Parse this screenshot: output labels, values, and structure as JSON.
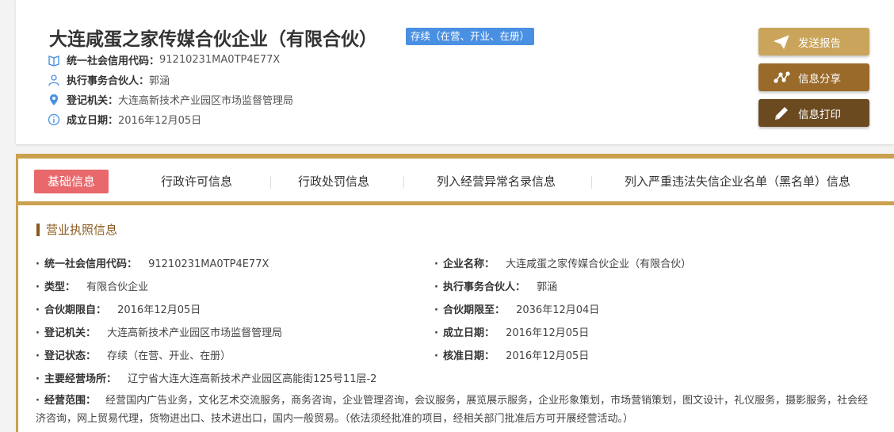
{
  "header": {
    "company_name": "大连咸蛋之家传媒合伙企业（有限合伙）",
    "status": "存续（在营、开业、在册）",
    "credit_code_label": "统一社会信用代码：",
    "credit_code": "91210231MA0TP4E77X",
    "partner_label": "执行事务合伙人：",
    "partner": "郭涵",
    "authority_label": "登记机关：",
    "authority": "大连高新技术产业园区市场监督管理局",
    "established_label": "成立日期：",
    "established": "2016年12月05日"
  },
  "actions": {
    "send": "发送报告",
    "share": "信息分享",
    "print": "信息打印"
  },
  "tabs": [
    {
      "label": "基础信息"
    },
    {
      "label": "行政许可信息"
    },
    {
      "label": "行政处罚信息"
    },
    {
      "label": "列入经营异常名录信息"
    },
    {
      "label": "列入严重违法失信企业名单（黑名单）信息"
    }
  ],
  "section": {
    "title": "营业执照信息"
  },
  "fields": {
    "credit_code": {
      "label": "统一社会信用代码：",
      "value": "91210231MA0TP4E77X"
    },
    "company_name": {
      "label": "企业名称：",
      "value": "大连咸蛋之家传媒合伙企业（有限合伙）"
    },
    "type": {
      "label": "类型：",
      "value": "有限合伙企业"
    },
    "partner": {
      "label": "执行事务合伙人：",
      "value": "郭涵"
    },
    "term_from": {
      "label": "合伙期限自：",
      "value": "2016年12月05日"
    },
    "term_to": {
      "label": "合伙期限至：",
      "value": "2036年12月04日"
    },
    "authority": {
      "label": "登记机关：",
      "value": "大连高新技术产业园区市场监督管理局"
    },
    "established": {
      "label": "成立日期：",
      "value": "2016年12月05日"
    },
    "reg_status": {
      "label": "登记状态：",
      "value": "存续（在营、开业、在册）"
    },
    "approved": {
      "label": "核准日期：",
      "value": "2016年12月05日"
    },
    "address": {
      "label": "主要经营场所：",
      "value": "辽宁省大连大连高新技术产业园区高能街125号11层-2"
    },
    "scope": {
      "label": "经营范围：",
      "value": "经营国内广告业务，文化艺术交流服务，商务咨询，企业管理咨询，会议服务，展览展示服务，企业形象策划，市场营销策划，图文设计，礼仪服务，摄影服务，社会经济咨询，网上贸易代理，货物进出口、技术进出口，国内一般贸易。（依法须经批准的项目，经相关部门批准后方可开展经营活动。）"
    }
  },
  "colors": {
    "accent_gold": "#c9a14f",
    "badge_blue": "#4a90e2",
    "active_tab": "#e8686b",
    "section_brown": "#8a5a1e"
  }
}
